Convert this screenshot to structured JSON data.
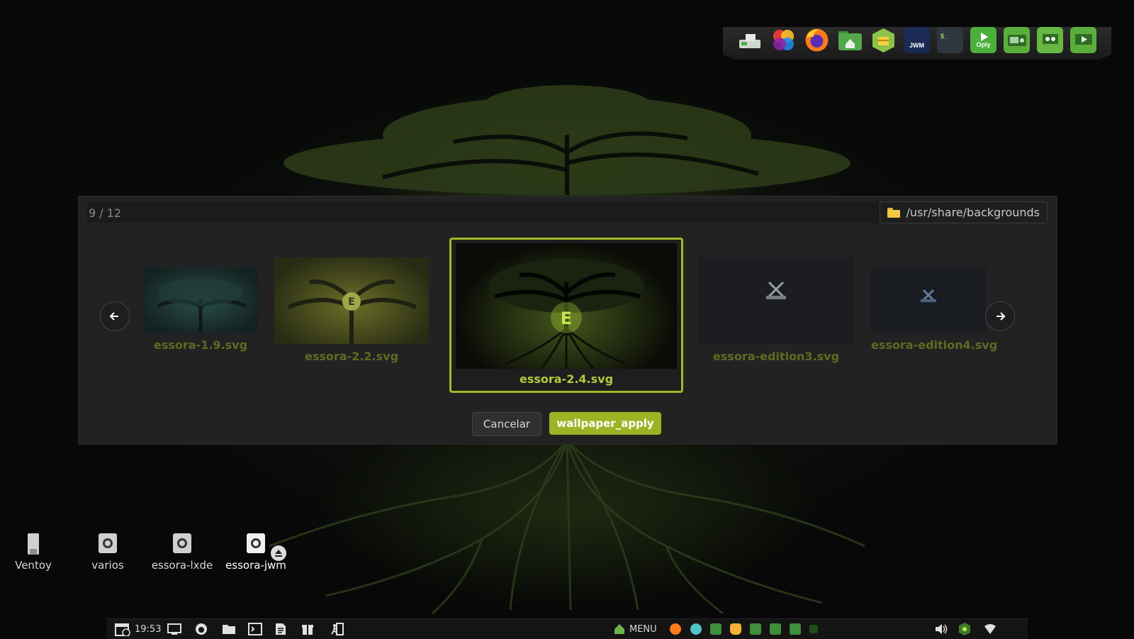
{
  "dialog": {
    "counter": "9 / 12",
    "path": "/usr/share/backgrounds",
    "thumbnails": [
      {
        "label": "essora-1.9.svg"
      },
      {
        "label": "essora-2.2.svg"
      },
      {
        "label": "essora-2.4.svg",
        "selected": true
      },
      {
        "label": "essora-edition3.svg"
      },
      {
        "label": "essora-edition4.svg"
      }
    ],
    "cancel_label": "Cancelar",
    "apply_label": "wallpaper_apply",
    "accent_color": "#9eb324"
  },
  "dock": {
    "icons": [
      "drive-mount-icon",
      "color-picker-icon",
      "firefox-icon",
      "home-folder-icon",
      "package-manager-icon",
      "jwm-settings-icon",
      "terminal-icon",
      "oply-icon",
      "oply-radio-icon",
      "oply-screen-icon",
      "oply-video-icon"
    ],
    "labels": {
      "jwm": "JWM",
      "terminal": "$_",
      "oply": "Oply"
    }
  },
  "desktop": {
    "drives": [
      {
        "label": "Ventoy",
        "icon": "usb-drive-icon"
      },
      {
        "label": "varios",
        "icon": "disk-icon"
      },
      {
        "label": "essora-lxde",
        "icon": "disk-icon"
      },
      {
        "label": "essora-jwm",
        "icon": "disk-icon",
        "mounted": true
      }
    ]
  },
  "taskbar": {
    "clock": "19:53",
    "menu_label": "MENU"
  }
}
